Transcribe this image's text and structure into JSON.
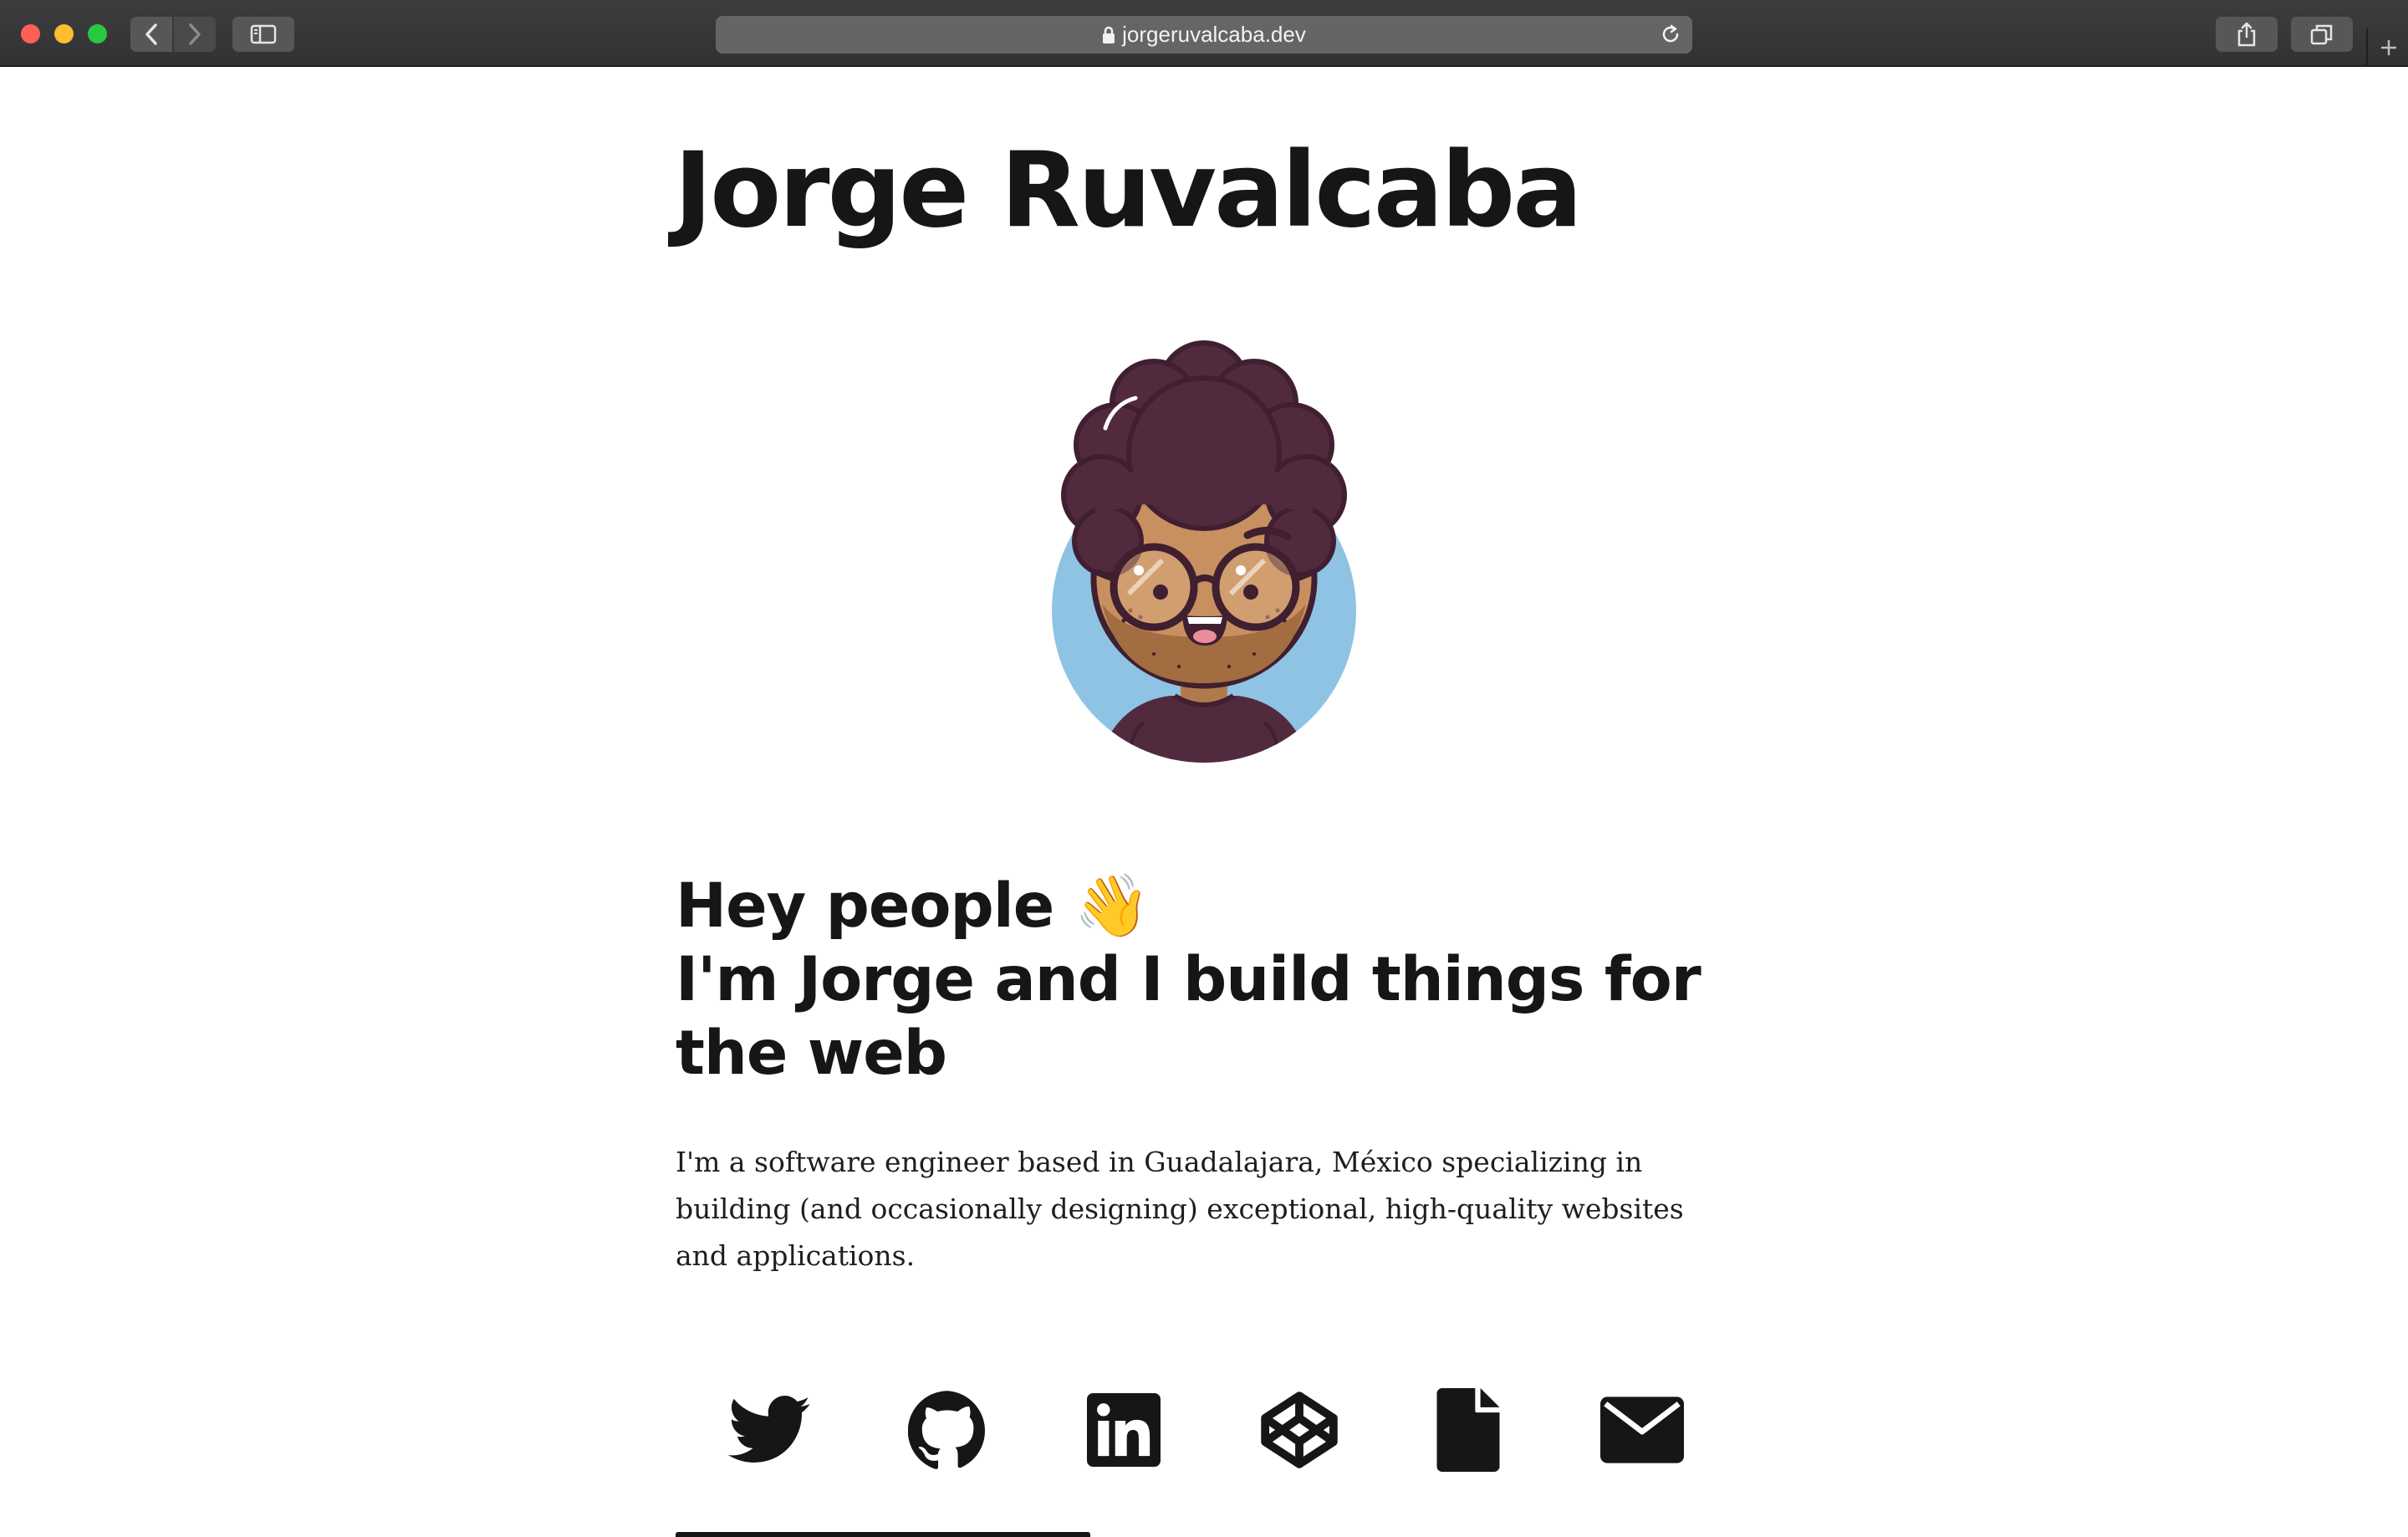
{
  "browser": {
    "url": "jorgeruvalcaba.dev"
  },
  "header": {
    "title": "Jorge Ruvalcaba"
  },
  "hero": {
    "greeting": "Hey people",
    "wave_emoji": "👋",
    "tagline": "I'm Jorge and I build things for the web"
  },
  "intro": {
    "text": "I'm a software engineer based in Guadalajara, México specializing in building (and occasionally designing) exceptional, high-quality websites and applications."
  },
  "social_links": [
    {
      "icon": "twitter-icon"
    },
    {
      "icon": "github-icon"
    },
    {
      "icon": "linkedin-icon"
    },
    {
      "icon": "codepen-icon"
    },
    {
      "icon": "resume-file-icon"
    },
    {
      "icon": "email-icon"
    }
  ],
  "colors": {
    "text": "#161616",
    "avatar_background": "#8ec3e4",
    "hair": "#522a3e",
    "skin": "#c89061"
  }
}
